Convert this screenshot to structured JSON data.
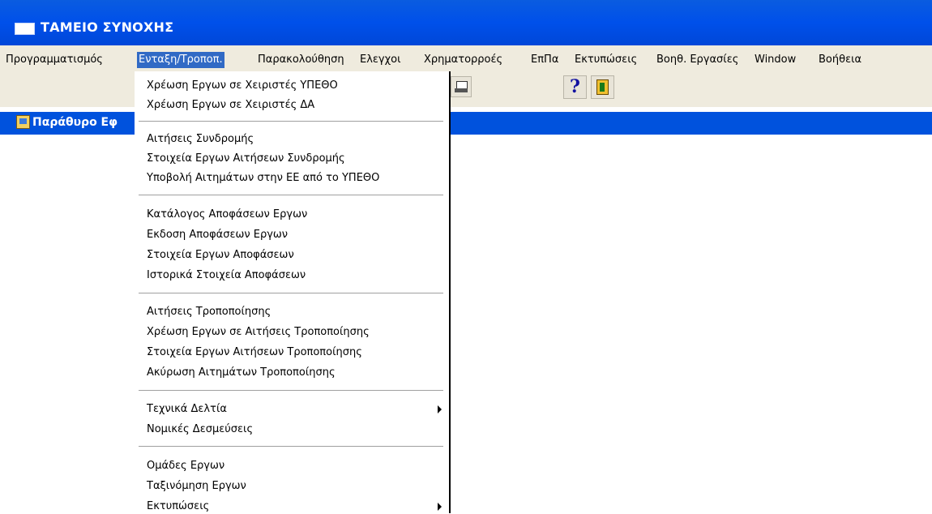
{
  "window": {
    "title": "ΤΑΜΕΙΟ ΣΥΝΟΧΗΣ"
  },
  "menubar": {
    "items": [
      {
        "label": "Προγραμματισμός",
        "active": false
      },
      {
        "label": "Ενταξη/Τροποπ.",
        "active": true
      },
      {
        "label": "Παρακολούθηση",
        "active": false
      },
      {
        "label": "Ελεγχοι",
        "active": false
      },
      {
        "label": "Χρηματορροές",
        "active": false
      },
      {
        "label": "ΕπΠα",
        "active": false
      },
      {
        "label": "Εκτυπώσεις",
        "active": false
      },
      {
        "label": "Βοηθ. Εργασίες",
        "active": false
      },
      {
        "label": "Window",
        "active": false
      },
      {
        "label": "Βοήθεια",
        "active": false
      }
    ]
  },
  "toolbar": {
    "buttons": [
      {
        "name": "print",
        "icon": "printer-icon"
      },
      {
        "name": "help",
        "icon": "help-icon",
        "glyph": "?"
      },
      {
        "name": "exit",
        "icon": "exit-door-icon"
      }
    ]
  },
  "child_window": {
    "title": "Παράθυρο Εφ"
  },
  "dropdown": {
    "items": [
      "Χρέωση Εργων σε Χειριστές ΥΠΕΘΟ",
      "Χρέωση Εργων σε Χειριστές ΔΑ",
      "Αιτήσεις Συνδρομής",
      "Στοιχεία Εργων Αιτήσεων Συνδρομής",
      "Υποβολή Αιτημάτων στην ΕΕ από το ΥΠΕΘΟ",
      "Κατάλογος Αποφάσεων Εργων",
      "Εκδοση Αποφάσεων Εργων",
      "Στοιχεία Εργων Αποφάσεων",
      "Ιστορικά Στοιχεία Αποφάσεων",
      "Αιτήσεις Τροποποίησης",
      "Χρέωση Εργων σε Αιτήσεις Τροποποίησης",
      "Στοιχεία Εργων Αιτήσεων Τροποποίησης",
      "Ακύρωση Αιτημάτων Τροποποίησης",
      "Τεχνικά Δελτία",
      "Νομικές Δεσμεύσεις",
      "Ομάδες Εργων",
      "Ταξινόμηση Εργων",
      "Εκτυπώσεις"
    ],
    "submenu_items": [
      "Τεχνικά Δελτία",
      "Εκτυπώσεις"
    ]
  },
  "colors": {
    "titlebar": "#0050ea",
    "menubar": "#efebde",
    "highlight": "#316ac5",
    "child_bar": "#0052dd"
  }
}
